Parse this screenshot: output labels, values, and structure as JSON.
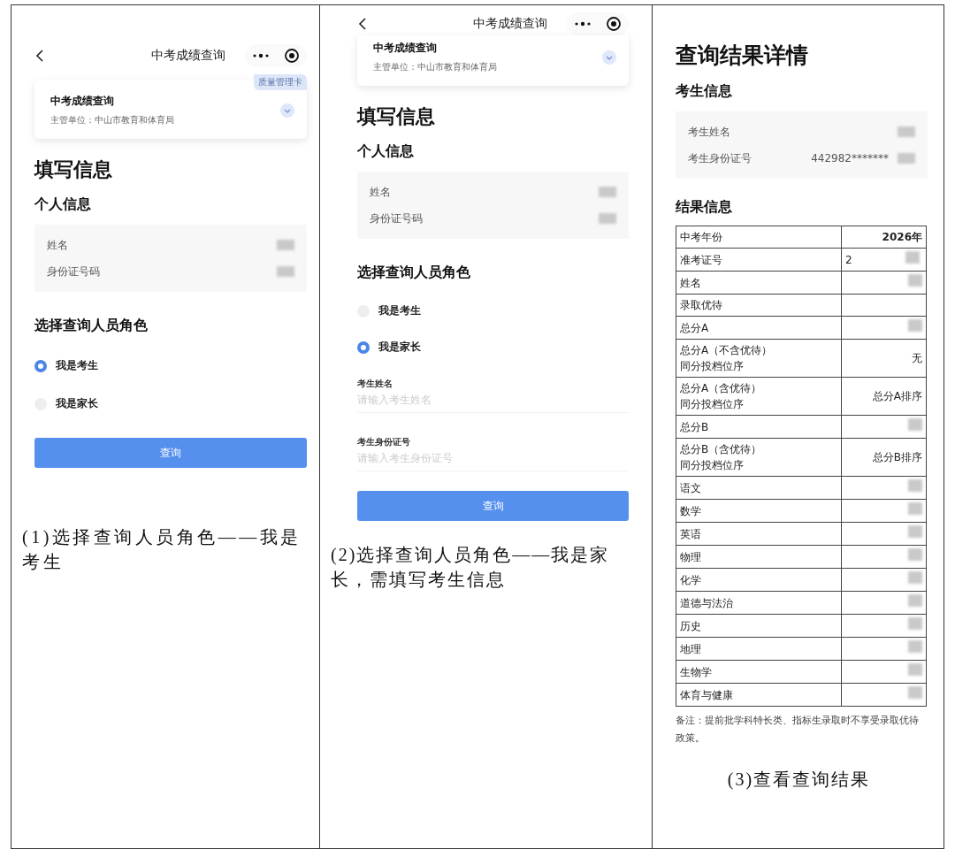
{
  "panels": [
    {
      "kind": "form",
      "nav": {
        "title": "中考成绩查询"
      },
      "service_card": {
        "title": "中考成绩查询",
        "subtitle": "主管单位：中山市教育和体育局",
        "badge": "质量管理卡"
      },
      "heading": "填写信息",
      "section": "个人信息",
      "info": [
        {
          "label": "姓名",
          "redacted": true
        },
        {
          "label": "身份证号码",
          "redacted": true
        }
      ],
      "role_title": "选择查询人员角色",
      "roles": [
        {
          "label": "我是考生",
          "selected": true
        },
        {
          "label": "我是家长",
          "selected": false
        }
      ],
      "button": "查询",
      "caption": "(1)选择查询人员角色——我是考生"
    },
    {
      "kind": "form",
      "nav": {
        "title": "中考成绩查询"
      },
      "service_card": {
        "title": "中考成绩查询",
        "subtitle": "主管单位：中山市教育和体育局"
      },
      "heading": "填写信息",
      "section": "个人信息",
      "info": [
        {
          "label": "姓名",
          "redacted": true
        },
        {
          "label": "身份证号码",
          "redacted": true
        }
      ],
      "role_title": "选择查询人员角色",
      "roles": [
        {
          "label": "我是考生",
          "selected": false
        },
        {
          "label": "我是家长",
          "selected": true
        }
      ],
      "fields": [
        {
          "label": "考生姓名",
          "placeholder": "请输入考生姓名"
        },
        {
          "label": "考生身份证号",
          "placeholder": "请输入考生身份证号"
        }
      ],
      "button": "查询",
      "caption": "(2)选择查询人员角色——我是家长，需填写考生信息"
    },
    {
      "kind": "result",
      "heading": "查询结果详情",
      "section": "考生信息",
      "info": [
        {
          "label": "考生姓名",
          "redacted": true
        },
        {
          "label": "考生身份证号",
          "value": "442982*******",
          "redacted": true
        }
      ],
      "result_title": "结果信息",
      "rows": [
        {
          "label": "中考年份",
          "value": "2026年"
        },
        {
          "label": "准考证号",
          "value": "2",
          "redacted": true
        },
        {
          "label": "姓名",
          "redacted": true
        },
        {
          "label": "录取优待"
        },
        {
          "label": "总分A",
          "redacted": true
        },
        {
          "lines": [
            "总分A（不含优待）",
            "同分投档位序"
          ],
          "value": "无"
        },
        {
          "lines": [
            "总分A（含优待）",
            "同分投档位序"
          ],
          "value": "总分A排序"
        },
        {
          "label": "总分B",
          "redacted": true
        },
        {
          "lines": [
            "总分B（含优待）",
            "同分投档位序"
          ],
          "value": "总分B排序"
        },
        {
          "label": "语文",
          "redacted": true
        },
        {
          "label": "数学",
          "redacted": true
        },
        {
          "label": "英语",
          "redacted": true
        },
        {
          "label": "物理",
          "redacted": true
        },
        {
          "label": "化学",
          "redacted": true
        },
        {
          "label": "道德与法治",
          "redacted": true
        },
        {
          "label": "历史",
          "redacted": true
        },
        {
          "label": "地理",
          "redacted": true
        },
        {
          "label": "生物学",
          "redacted": true
        },
        {
          "label": "体育与健康",
          "redacted": true
        }
      ],
      "note": "备注：提前批学科特长类、指标生录取时不享受录取优待政策。",
      "caption": "(3)查看查询结果"
    }
  ]
}
